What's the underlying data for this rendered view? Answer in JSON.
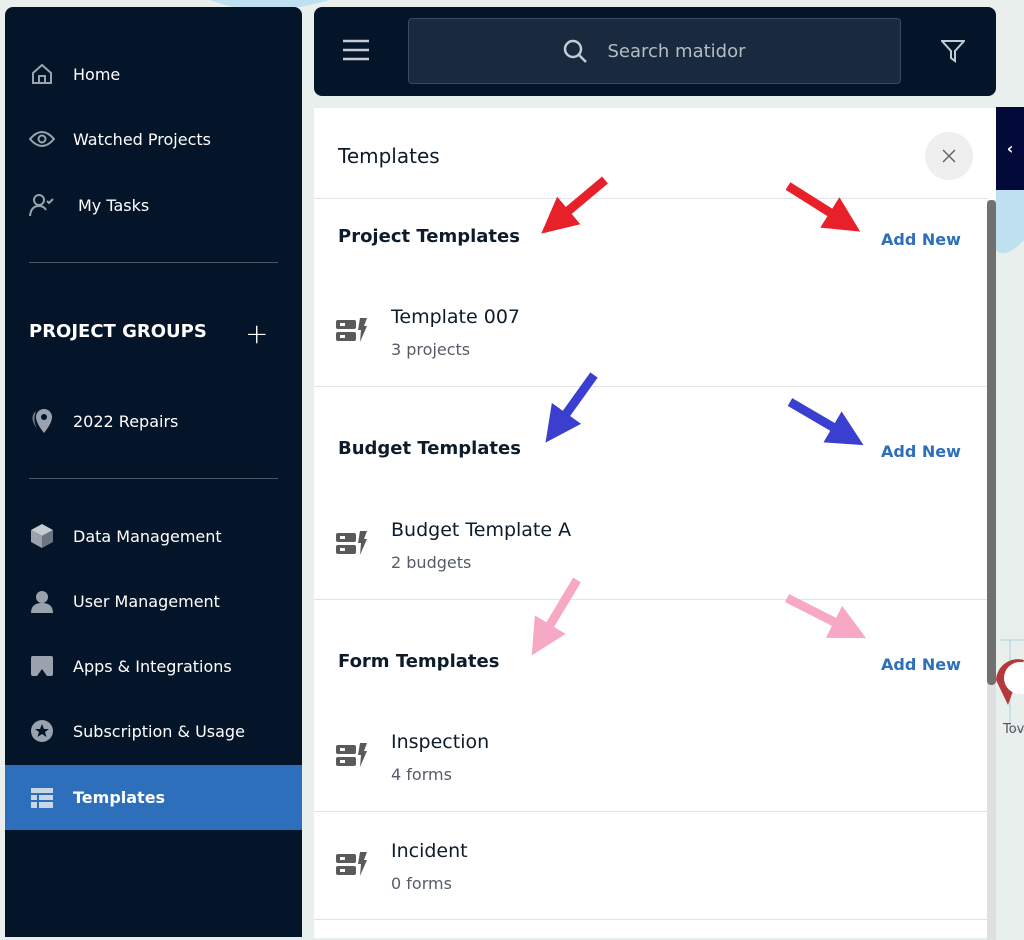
{
  "sidebar": {
    "items": [
      {
        "label": "Home",
        "icon": "home-icon"
      },
      {
        "label": "Watched Projects",
        "icon": "eye-icon"
      },
      {
        "label": "My Tasks",
        "icon": "user-check-icon"
      }
    ],
    "project_groups_label": "PROJECT GROUPS",
    "groups": [
      {
        "label": "2022 Repairs",
        "icon": "map-pin-icon"
      }
    ],
    "admin_items": [
      {
        "label": "Data Management",
        "icon": "cube-icon"
      },
      {
        "label": "User Management",
        "icon": "user-icon"
      },
      {
        "label": "Apps & Integrations",
        "icon": "apps-icon"
      },
      {
        "label": "Subscription & Usage",
        "icon": "star-icon"
      },
      {
        "label": "Templates",
        "icon": "table-icon",
        "active": true
      }
    ]
  },
  "header": {
    "search_placeholder": "Search matidor"
  },
  "panel": {
    "title": "Templates",
    "sections": [
      {
        "title": "Project Templates",
        "add_label": "Add New",
        "items": [
          {
            "name": "Template 007",
            "count": "3 projects"
          }
        ]
      },
      {
        "title": "Budget Templates",
        "add_label": "Add New",
        "items": [
          {
            "name": "Budget Template A",
            "count": "2 budgets"
          }
        ]
      },
      {
        "title": "Form Templates",
        "add_label": "Add New",
        "items": [
          {
            "name": "Inspection",
            "count": "4 forms"
          },
          {
            "name": "Incident",
            "count": "0 forms"
          }
        ]
      }
    ]
  },
  "map_labels": {
    "right": "Tov"
  },
  "colors": {
    "sidebar": "#04152a",
    "accent": "#2d6fba",
    "arrow_red": "#e8202a",
    "arrow_blue": "#3a3fcf",
    "arrow_pink": "#f7a8c4"
  }
}
